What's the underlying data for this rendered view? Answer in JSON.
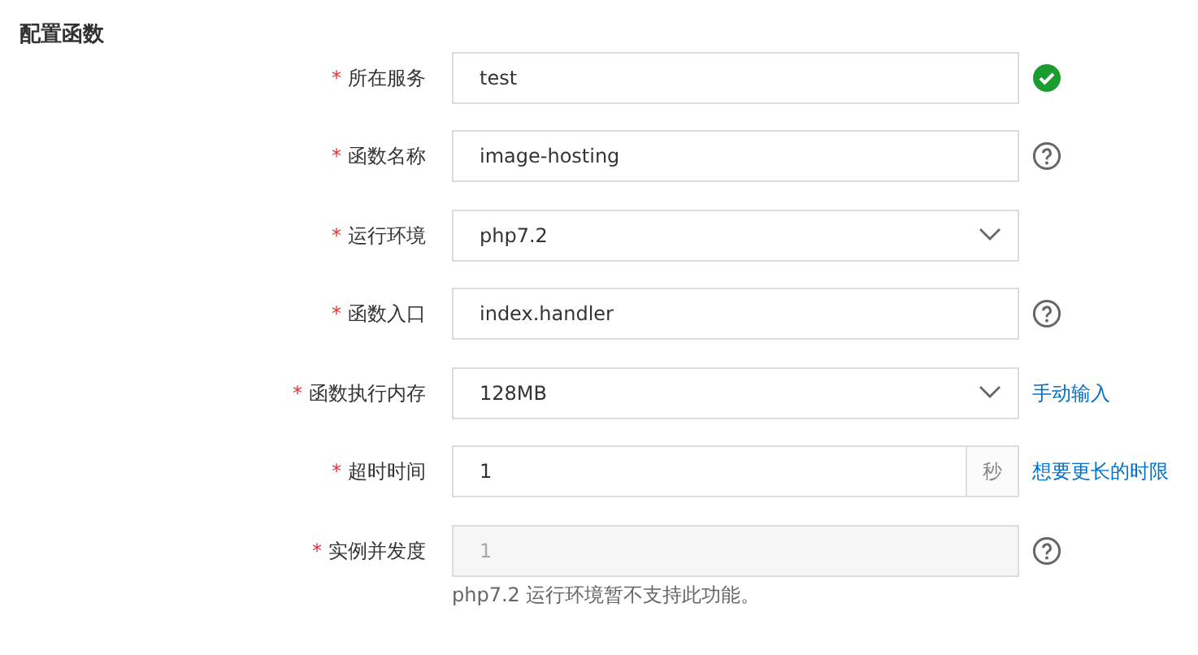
{
  "title": "配置函数",
  "fields": [
    {
      "marker": "*",
      "label": "所在服务",
      "kind": "input",
      "value": "test",
      "disabled": false,
      "aside": {
        "kind": "check"
      }
    },
    {
      "marker": "*",
      "label": "函数名称",
      "kind": "input",
      "value": "image-hosting",
      "disabled": false,
      "aside": {
        "kind": "help"
      }
    },
    {
      "marker": "*",
      "label": "运行环境",
      "kind": "select",
      "value": "php7.2",
      "disabled": false
    },
    {
      "marker": "*",
      "label": "函数入口",
      "kind": "input",
      "value": "index.handler",
      "disabled": false,
      "aside": {
        "kind": "help"
      }
    },
    {
      "marker": "*",
      "label": "函数执行内存",
      "kind": "select",
      "value": "128MB",
      "disabled": false,
      "aside": {
        "kind": "link",
        "text": "手动输入"
      }
    },
    {
      "marker": "*",
      "label": "超时时间",
      "kind": "unit",
      "value": "1",
      "unit": "秒",
      "disabled": false,
      "aside": {
        "kind": "link",
        "text": "想要更长的时限"
      }
    },
    {
      "marker": "*",
      "label": "实例并发度",
      "kind": "input",
      "value": "1",
      "disabled": true,
      "aside": {
        "kind": "help"
      },
      "hint": "php7.2 运行环境暂不支持此功能。"
    }
  ]
}
